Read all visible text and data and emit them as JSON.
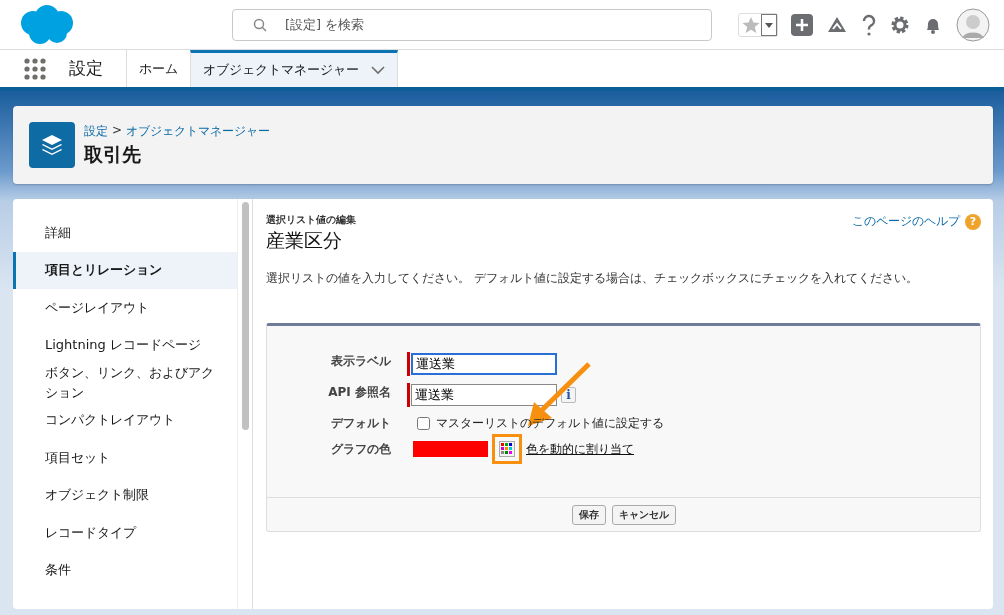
{
  "header": {
    "search": {
      "placeholder": "[設定] を検索"
    }
  },
  "nav": {
    "app_name": "設定",
    "tabs": [
      {
        "label": "ホーム",
        "selected": false,
        "has_menu": false
      },
      {
        "label": "オブジェクトマネージャー",
        "selected": true,
        "has_menu": true
      }
    ]
  },
  "page_header": {
    "breadcrumb": [
      {
        "label": "設定"
      },
      {
        "label": "オブジェクトマネージャー"
      }
    ],
    "breadcrumb_separator": ">",
    "title": "取引先"
  },
  "sidebar": {
    "items": [
      {
        "label": "詳細",
        "selected": false
      },
      {
        "label": "項目とリレーション",
        "selected": true
      },
      {
        "label": "ページレイアウト",
        "selected": false
      },
      {
        "label": "Lightning レコードページ",
        "selected": false
      },
      {
        "label": "ボタン、リンク、およびアクション",
        "selected": false
      },
      {
        "label": "コンパクトレイアウト",
        "selected": false
      },
      {
        "label": "項目セット",
        "selected": false
      },
      {
        "label": "オブジェクト制限",
        "selected": false
      },
      {
        "label": "レコードタイプ",
        "selected": false
      },
      {
        "label": "条件",
        "selected": false
      }
    ]
  },
  "main": {
    "subtitle": "選択リスト値の編集",
    "title": "産業区分",
    "help_link": "このページのヘルプ",
    "help_icon": "?",
    "instructions": "選択リストの値を入力してください。 デフォルト値に設定する場合は、チェックボックスにチェックを入れてください。",
    "fields": [
      {
        "kind": "text",
        "label": "表示ラベル",
        "value": "運送業",
        "required": true,
        "focused": true,
        "info": false
      },
      {
        "kind": "text",
        "label": "API 参照名",
        "value": "運送業",
        "required": true,
        "focused": false,
        "info": true,
        "info_icon": "i"
      },
      {
        "kind": "checkbox",
        "label": "デフォルト",
        "option": "マスターリストのデフォルト値に設定する",
        "checked": false
      },
      {
        "kind": "color",
        "label": "グラフの色",
        "color": "#ff0000",
        "link": "色を動的に割り当て",
        "highlighted": true
      }
    ],
    "buttons": [
      {
        "label": "保存"
      },
      {
        "label": "キャンセル"
      }
    ]
  }
}
